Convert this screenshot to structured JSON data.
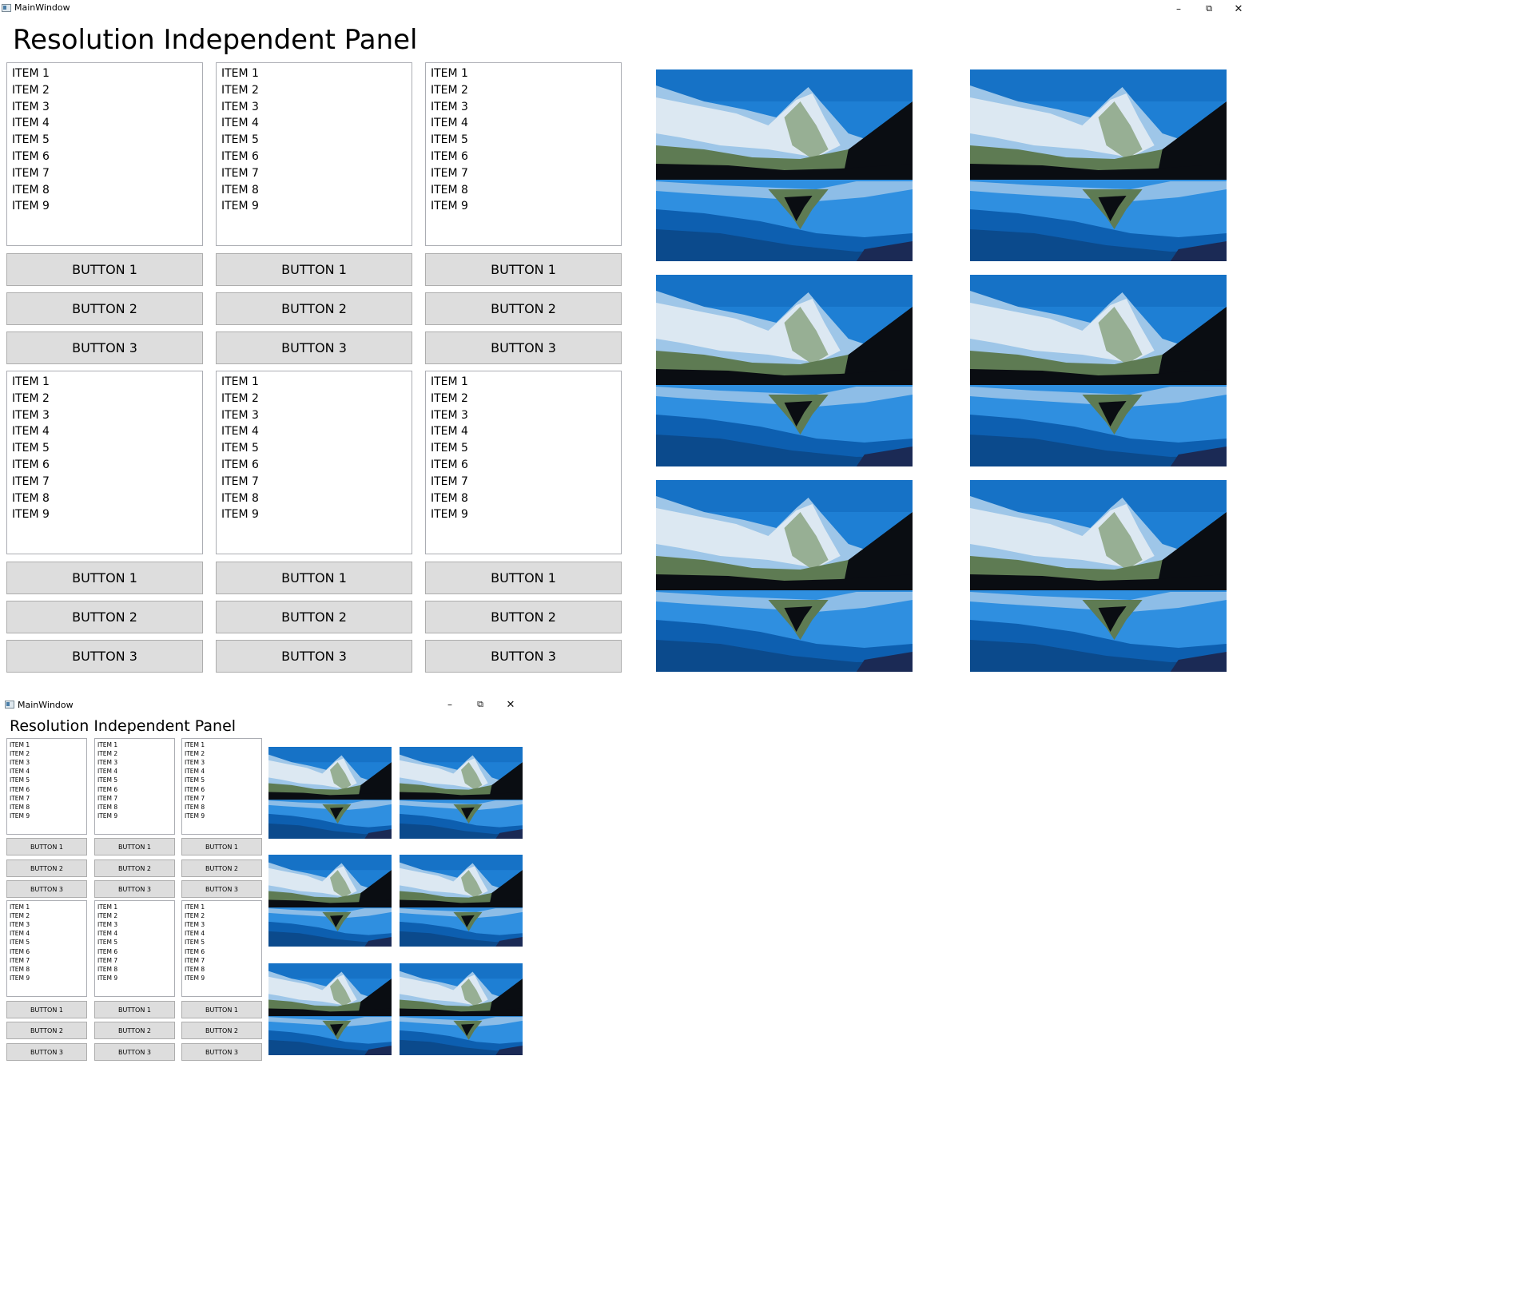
{
  "windows": [
    {
      "title": "MainWindow",
      "heading": "Resolution Independent Panel",
      "controls": {
        "minimize": "–",
        "restore": "⧉",
        "close": "✕"
      },
      "panels": [
        {
          "items": [
            "ITEM 1",
            "ITEM 2",
            "ITEM 3",
            "ITEM 4",
            "ITEM 5",
            "ITEM 6",
            "ITEM 7",
            "ITEM 8",
            "ITEM 9"
          ],
          "buttons": [
            "BUTTON 1",
            "BUTTON 2",
            "BUTTON 3"
          ]
        },
        {
          "items": [
            "ITEM 1",
            "ITEM 2",
            "ITEM 3",
            "ITEM 4",
            "ITEM 5",
            "ITEM 6",
            "ITEM 7",
            "ITEM 8",
            "ITEM 9"
          ],
          "buttons": [
            "BUTTON 1",
            "BUTTON 2",
            "BUTTON 3"
          ]
        },
        {
          "items": [
            "ITEM 1",
            "ITEM 2",
            "ITEM 3",
            "ITEM 4",
            "ITEM 5",
            "ITEM 6",
            "ITEM 7",
            "ITEM 8",
            "ITEM 9"
          ],
          "buttons": [
            "BUTTON 1",
            "BUTTON 2",
            "BUTTON 3"
          ]
        },
        {
          "items": [
            "ITEM 1",
            "ITEM 2",
            "ITEM 3",
            "ITEM 4",
            "ITEM 5",
            "ITEM 6",
            "ITEM 7",
            "ITEM 8",
            "ITEM 9"
          ],
          "buttons": [
            "BUTTON 1",
            "BUTTON 2",
            "BUTTON 3"
          ]
        },
        {
          "items": [
            "ITEM 1",
            "ITEM 2",
            "ITEM 3",
            "ITEM 4",
            "ITEM 5",
            "ITEM 6",
            "ITEM 7",
            "ITEM 8",
            "ITEM 9"
          ],
          "buttons": [
            "BUTTON 1",
            "BUTTON 2",
            "BUTTON 3"
          ]
        },
        {
          "items": [
            "ITEM 1",
            "ITEM 2",
            "ITEM 3",
            "ITEM 4",
            "ITEM 5",
            "ITEM 6",
            "ITEM 7",
            "ITEM 8",
            "ITEM 9"
          ],
          "buttons": [
            "BUTTON 1",
            "BUTTON 2",
            "BUTTON 3"
          ]
        }
      ],
      "images": [
        {
          "subject": "mountain-lake-landscape"
        },
        {
          "subject": "mountain-lake-landscape"
        },
        {
          "subject": "mountain-lake-landscape"
        },
        {
          "subject": "mountain-lake-landscape"
        },
        {
          "subject": "mountain-lake-landscape"
        },
        {
          "subject": "mountain-lake-landscape"
        }
      ]
    },
    {
      "title": "MainWindow",
      "heading": "Resolution Independent Panel",
      "controls": {
        "minimize": "–",
        "restore": "⧉",
        "close": "✕"
      },
      "panels": [
        {
          "items": [
            "ITEM 1",
            "ITEM 2",
            "ITEM 3",
            "ITEM 4",
            "ITEM 5",
            "ITEM 6",
            "ITEM 7",
            "ITEM 8",
            "ITEM 9"
          ],
          "buttons": [
            "BUTTON 1",
            "BUTTON 2",
            "BUTTON 3"
          ]
        },
        {
          "items": [
            "ITEM 1",
            "ITEM 2",
            "ITEM 3",
            "ITEM 4",
            "ITEM 5",
            "ITEM 6",
            "ITEM 7",
            "ITEM 8",
            "ITEM 9"
          ],
          "buttons": [
            "BUTTON 1",
            "BUTTON 2",
            "BUTTON 3"
          ]
        },
        {
          "items": [
            "ITEM 1",
            "ITEM 2",
            "ITEM 3",
            "ITEM 4",
            "ITEM 5",
            "ITEM 6",
            "ITEM 7",
            "ITEM 8",
            "ITEM 9"
          ],
          "buttons": [
            "BUTTON 1",
            "BUTTON 2",
            "BUTTON 3"
          ]
        },
        {
          "items": [
            "ITEM 1",
            "ITEM 2",
            "ITEM 3",
            "ITEM 4",
            "ITEM 5",
            "ITEM 6",
            "ITEM 7",
            "ITEM 8",
            "ITEM 9"
          ],
          "buttons": [
            "BUTTON 1",
            "BUTTON 2",
            "BUTTON 3"
          ]
        },
        {
          "items": [
            "ITEM 1",
            "ITEM 2",
            "ITEM 3",
            "ITEM 4",
            "ITEM 5",
            "ITEM 6",
            "ITEM 7",
            "ITEM 8",
            "ITEM 9"
          ],
          "buttons": [
            "BUTTON 1",
            "BUTTON 2",
            "BUTTON 3"
          ]
        },
        {
          "items": [
            "ITEM 1",
            "ITEM 2",
            "ITEM 3",
            "ITEM 4",
            "ITEM 5",
            "ITEM 6",
            "ITEM 7",
            "ITEM 8",
            "ITEM 9"
          ],
          "buttons": [
            "BUTTON 1",
            "BUTTON 2",
            "BUTTON 3"
          ]
        }
      ],
      "images": [
        {
          "subject": "mountain-lake-landscape"
        },
        {
          "subject": "mountain-lake-landscape"
        },
        {
          "subject": "mountain-lake-landscape"
        },
        {
          "subject": "mountain-lake-landscape"
        },
        {
          "subject": "mountain-lake-landscape"
        },
        {
          "subject": "mountain-lake-landscape"
        }
      ]
    }
  ],
  "colors": {
    "sky": "#1e7fd4",
    "snow": "#dce8f2",
    "ice": "#9ec6e8",
    "rock": "#5e7b53",
    "dark": "#0a0d12",
    "water": "#2f8fe0",
    "deep": "#0d5fb0",
    "button_bg": "#dddddd",
    "list_border": "#abadb3"
  }
}
